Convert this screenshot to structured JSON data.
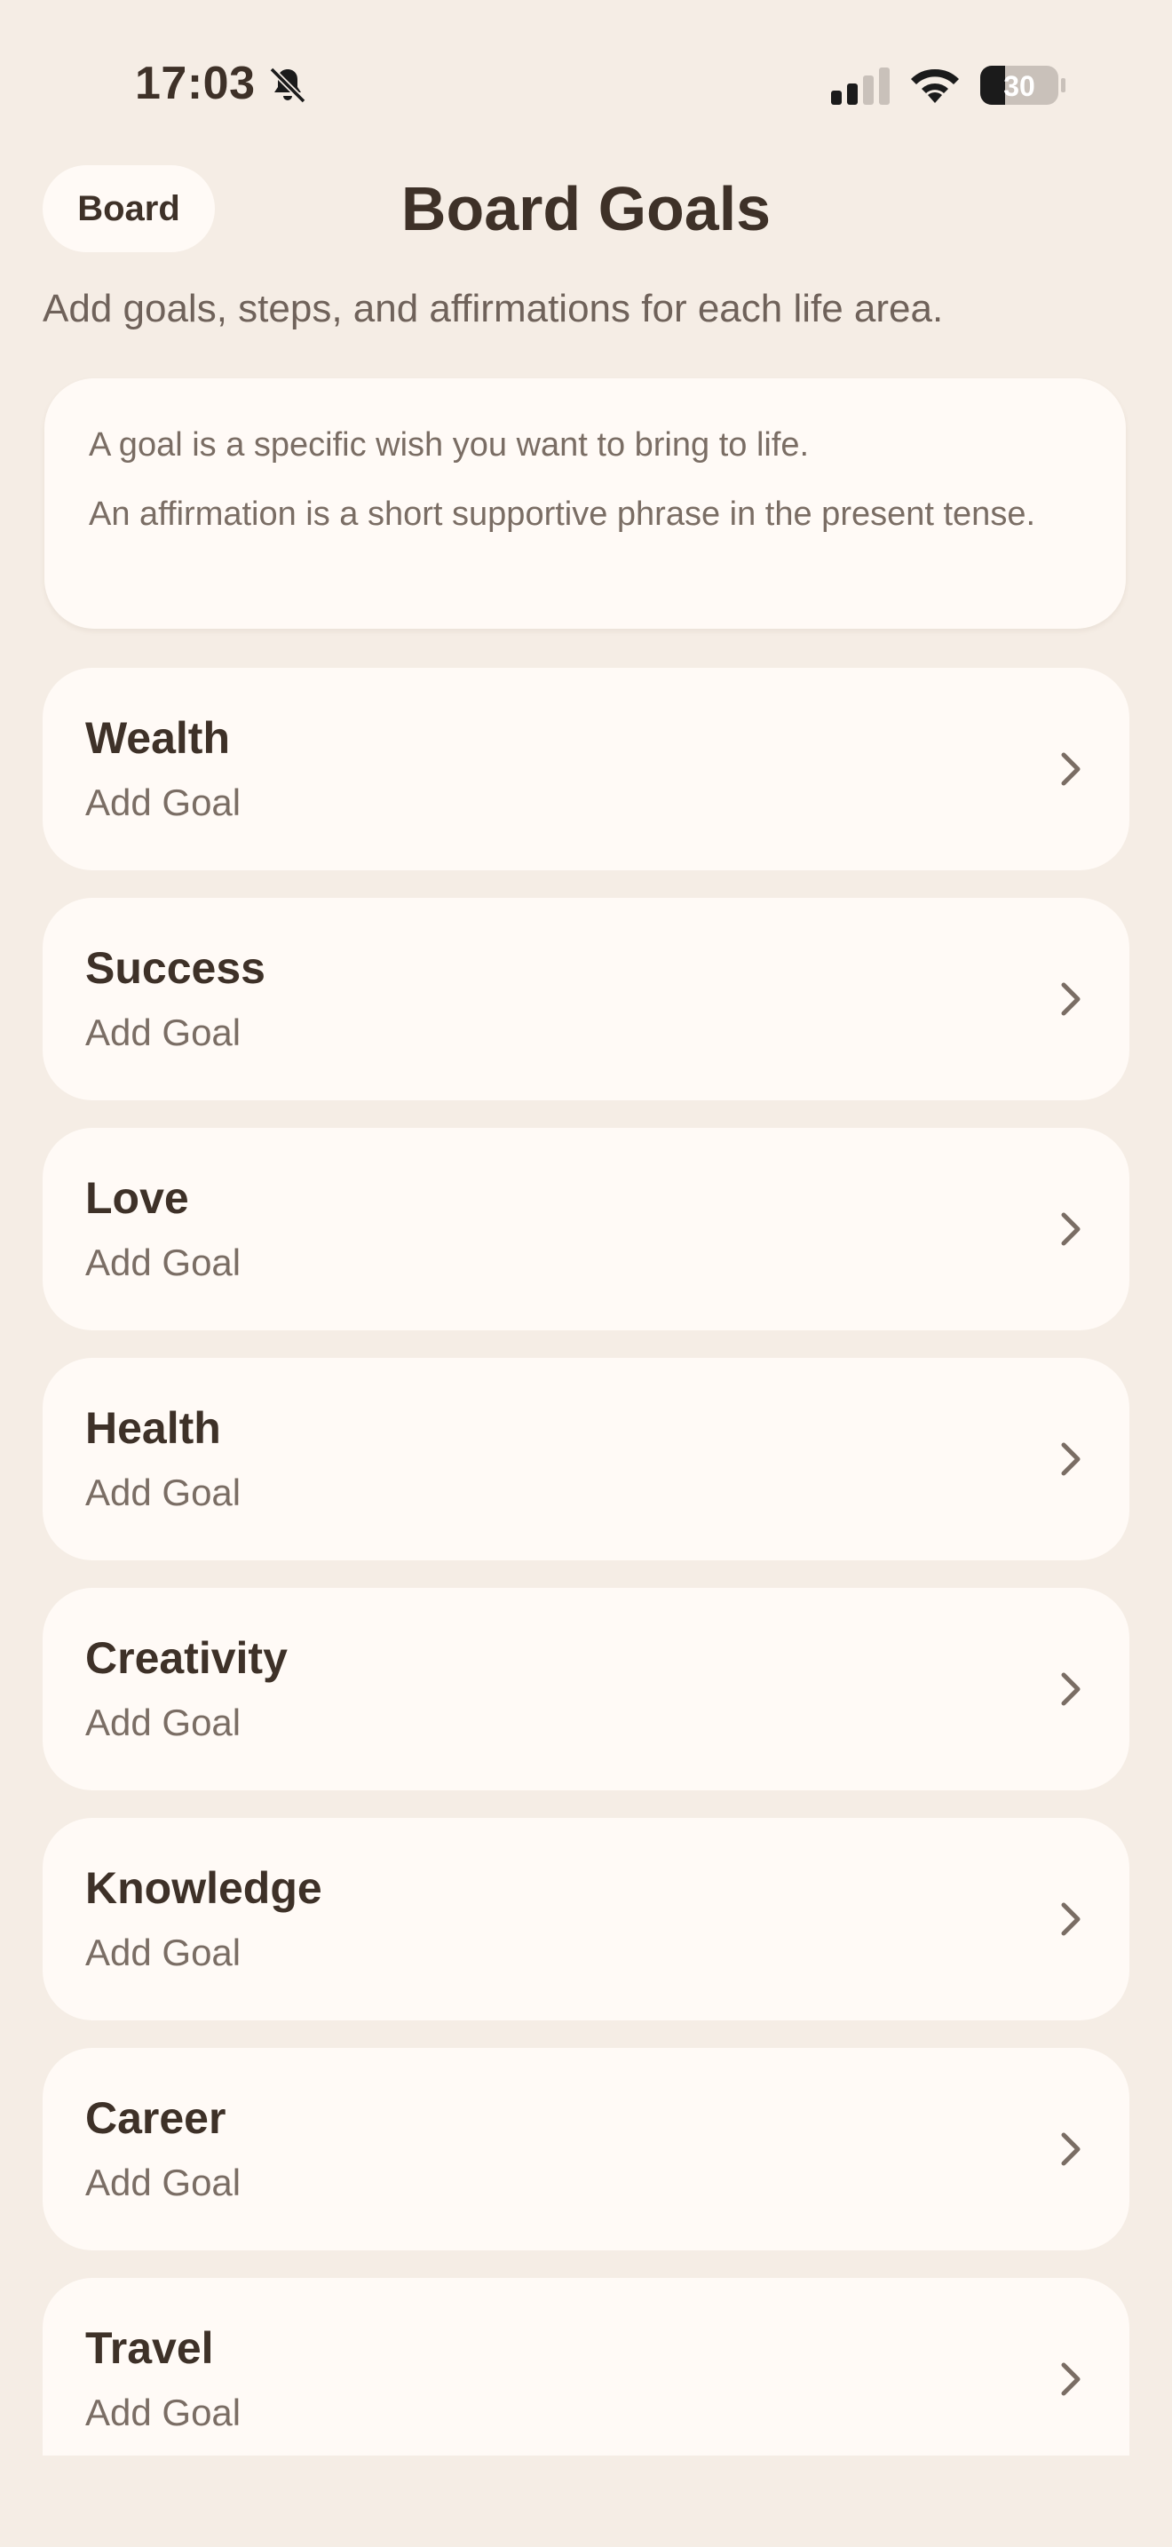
{
  "status_bar": {
    "time": "17:03",
    "battery_level": "30",
    "icons": [
      "bell-slash-icon",
      "cellular-signal-icon",
      "wifi-icon",
      "battery-icon"
    ]
  },
  "header": {
    "back_label": "Board",
    "title": "Board Goals",
    "subtitle": "Add goals, steps, and affirmations for each life area."
  },
  "info": {
    "goal_definition": "A goal is a specific wish you want to bring to life.",
    "affirmation_definition": "An affirmation is a short supportive phrase in the present tense."
  },
  "categories": [
    {
      "name": "Wealth",
      "action": "Add Goal"
    },
    {
      "name": "Success",
      "action": "Add Goal"
    },
    {
      "name": "Love",
      "action": "Add Goal"
    },
    {
      "name": "Health",
      "action": "Add Goal"
    },
    {
      "name": "Creativity",
      "action": "Add Goal"
    },
    {
      "name": "Knowledge",
      "action": "Add Goal"
    },
    {
      "name": "Career",
      "action": "Add Goal"
    },
    {
      "name": "Travel",
      "action": "Add Goal"
    }
  ],
  "colors": {
    "background": "#f5ede5",
    "card": "#fffaf6",
    "text_primary": "#3e3128",
    "text_secondary": "#7a6d64"
  }
}
